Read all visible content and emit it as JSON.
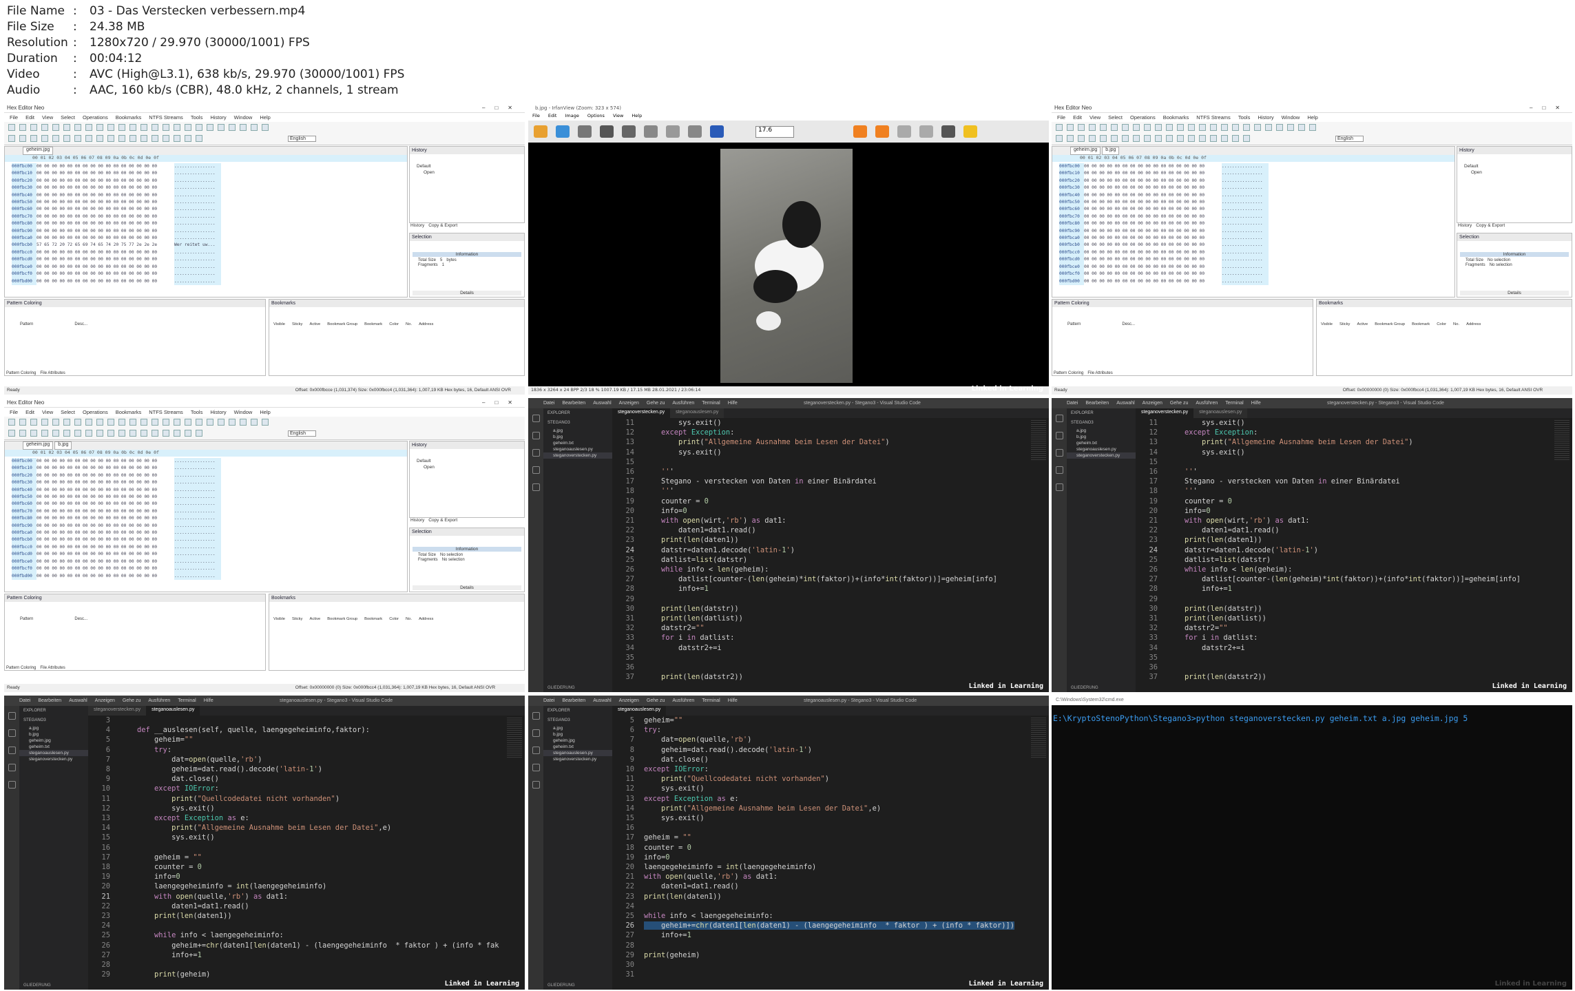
{
  "meta": {
    "rows": [
      {
        "key": "File Name",
        "value": "03 - Das Verstecken verbessern.mp4"
      },
      {
        "key": "File Size",
        "value": "24.38 MB"
      },
      {
        "key": "Resolution",
        "value": "1280x720 / 29.970 (30000/1001) FPS"
      },
      {
        "key": "Duration",
        "value": "00:04:12"
      },
      {
        "key": "Video",
        "value": "AVC (High@L3.1), 638 kb/s, 29.970 (30000/1001) FPS"
      },
      {
        "key": "Audio",
        "value": "AAC, 160 kb/s (CBR), 48.0 kHz, 2 channels, 1 stream"
      }
    ],
    "colon": ":"
  },
  "hex": {
    "title": "Hex Editor Neo",
    "menu": [
      "File",
      "Edit",
      "View",
      "Select",
      "Operations",
      "Bookmarks",
      "NTFS Streams",
      "Tools",
      "History",
      "Window",
      "Help"
    ],
    "tab1": "geheim.jpg",
    "tab2": "b.jpg",
    "lang": "English",
    "header": "00 01 02 03  04 05 06 07  08 09 0a 0b  0c 0d 0e 0f",
    "history": "History",
    "default": "Default",
    "open": "Open",
    "history_tab": "History",
    "copy_export": "Copy & Export",
    "selection": "Selection",
    "information": "Information",
    "total_size": "Total Size",
    "fragments": "Fragments",
    "total_val_1": "5",
    "bytes": "bytes",
    "frag_val_1": "1",
    "no_selection": "No selection",
    "details": "Details",
    "pattern_coloring": "Pattern Coloring",
    "bookmarks": "Bookmarks",
    "pattern_col": "Pattern",
    "desc_col": "Desc...",
    "visible": "Visible",
    "sticky": "Sticky",
    "active": "Active",
    "bm_group": "Bookmark Group",
    "bookmark": "Bookmark",
    "color": "Color",
    "no": "No.",
    "address": "Address",
    "pc_tab": "Pattern Coloring",
    "file_attr": "File Attributes",
    "ready": "Ready",
    "status1": "Offset: 0x000fbcce (1,031,374)  Size: 0x000fbcc4 (1,031,364): 1,007,19 KB  Hex bytes, 16, Default ANSI  OVR",
    "status2": "Offset: 0x00000000 (0)  Size: 0x000fbcc4 (1,031,364): 1,007,19 KB  Hex bytes, 16, Default ANSI  OVR",
    "offsets": [
      "000fbc00",
      "000fbc10",
      "000fbc20",
      "000fbc30",
      "000fbc40",
      "000fbc50",
      "000fbc60",
      "000fbc70",
      "000fbc80",
      "000fbc90",
      "000fbca0",
      "000fbcb0",
      "000fbcc0",
      "000fbcd0",
      "000fbce0",
      "000fbcf0",
      "000fbd00"
    ],
    "bytes_row": "00 00 00 00  00 00 00 00  00 00 00 00  00 00 00 00",
    "ascii_row": "................",
    "msg_row": "57 65 72 20  72 65 69 74  65 74 20 75  77 2e 2e 2e",
    "msg_ascii": "Wer reitet uw..."
  },
  "viewer": {
    "title": "b.jpg - IrfanView (Zoom: 323 x 574)",
    "menu": [
      "File",
      "Edit",
      "Image",
      "Options",
      "View",
      "Help"
    ],
    "zoom": "17.6",
    "status": "1836 x 3264 x 24 BPP   2/3   18 %   1007.19 KB / 17.15 MB   28.01.2021 / 23:06:14"
  },
  "vs": {
    "menu": [
      "Datei",
      "Bearbeiten",
      "Auswahl",
      "Anzeigen",
      "Gehe zu",
      "Ausführen",
      "Terminal",
      "Hilfe"
    ],
    "title_a": "steganoverstecken.py - Stegano3 - Visual Studio Code",
    "title_b": "steganoauslesen.py - Stegano3 - Visual Studio Code",
    "explorer": "EXPLORER",
    "folder": "STEGANO3",
    "gliederung": "GLIEDERUNG",
    "files": [
      "a.jpg",
      "b.jpg",
      "geheim.txt",
      "steganoauslesen.py",
      "steganoverstecken.py"
    ],
    "files7": [
      "a.jpg",
      "b.jpg",
      "geheim.jpg",
      "geheim.txt",
      "steganoauslesen.py",
      "steganoverstecken.py"
    ],
    "files8": [
      "a.jpg",
      "b.jpg",
      "geheim.jpg",
      "geheim.txt",
      "steganoauslesen.py",
      "steganoverstecken.py"
    ],
    "tab_ver": "steganoverstecken.py",
    "tab_aus": "steganoauslesen.py",
    "code_ver": [
      [
        "11",
        "        sys.exit()"
      ],
      [
        "12",
        "    except Exception:"
      ],
      [
        "13",
        "        print(\"Allgemeine Ausnahme beim Lesen der Datei\")"
      ],
      [
        "14",
        "        sys.exit()"
      ],
      [
        "15",
        ""
      ],
      [
        "16",
        "    '''"
      ],
      [
        "17",
        "    Stegano - verstecken von Daten in einer Binärdatei"
      ],
      [
        "18",
        "    '''"
      ],
      [
        "19",
        "    counter = 0"
      ],
      [
        "20",
        "    info=0"
      ],
      [
        "21",
        "    with open(wirt,'rb') as dat1:"
      ],
      [
        "22",
        "        daten1=dat1.read()"
      ],
      [
        "23",
        "    print(len(daten1))"
      ],
      [
        "24",
        "    datstr=daten1.decode('latin-1')"
      ],
      [
        "25",
        "    datlist=list(datstr)"
      ],
      [
        "26",
        "    while info < len(geheim):"
      ],
      [
        "27",
        "        datlist[counter-(len(geheim)*int(faktor))+(info*int(faktor))]=geheim[info]"
      ],
      [
        "28",
        "        info+=1"
      ],
      [
        "29",
        ""
      ],
      [
        "30",
        "    print(len(datstr))"
      ],
      [
        "31",
        "    print(len(datlist))"
      ],
      [
        "32",
        "    datstr2=\"\""
      ],
      [
        "33",
        "    for i in datlist:"
      ],
      [
        "34",
        "        datstr2+=i"
      ],
      [
        "35",
        ""
      ],
      [
        "36",
        ""
      ],
      [
        "37",
        "    print(len(datstr2))"
      ]
    ],
    "code_aus7": [
      [
        "3",
        ""
      ],
      [
        "4",
        "    def __auslesen(self, quelle, laengegeheiminfo,faktor):"
      ],
      [
        "5",
        "        geheim=\"\""
      ],
      [
        "6",
        "        try:"
      ],
      [
        "7",
        "            dat=open(quelle,'rb')"
      ],
      [
        "8",
        "            geheim=dat.read().decode('latin-1')"
      ],
      [
        "9",
        "            dat.close()"
      ],
      [
        "10",
        "        except IOError:"
      ],
      [
        "11",
        "            print(\"Quellcodedatei nicht vorhanden\")"
      ],
      [
        "12",
        "            sys.exit()"
      ],
      [
        "13",
        "        except Exception as e:"
      ],
      [
        "14",
        "            print(\"Allgemeine Ausnahme beim Lesen der Datei\",e)"
      ],
      [
        "15",
        "            sys.exit()"
      ],
      [
        "16",
        ""
      ],
      [
        "17",
        "        geheim = \"\""
      ],
      [
        "18",
        "        counter = 0"
      ],
      [
        "19",
        "        info=0"
      ],
      [
        "20",
        "        laengegeheiminfo = int(laengegeheiminfo)"
      ],
      [
        "21",
        "        with open(quelle,'rb') as dat1:"
      ],
      [
        "22",
        "            daten1=dat1.read()"
      ],
      [
        "23",
        "        print(len(daten1))"
      ],
      [
        "24",
        ""
      ],
      [
        "25",
        "        while info < laengegeheiminfo:"
      ],
      [
        "26",
        "            geheim+=chr(daten1[len(daten1) - (laengegeheiminfo  * faktor ) + (info * fak"
      ],
      [
        "27",
        "            info+=1"
      ],
      [
        "28",
        ""
      ],
      [
        "29",
        "        print(geheim)"
      ]
    ],
    "code_aus8": [
      [
        "5",
        "geheim=\"\""
      ],
      [
        "6",
        "try:"
      ],
      [
        "7",
        "    dat=open(quelle,'rb')"
      ],
      [
        "8",
        "    geheim=dat.read().decode('latin-1')"
      ],
      [
        "9",
        "    dat.close()"
      ],
      [
        "10",
        "except IOError:"
      ],
      [
        "11",
        "    print(\"Quellcodedatei nicht vorhanden\")"
      ],
      [
        "12",
        "    sys.exit()"
      ],
      [
        "13",
        "except Exception as e:"
      ],
      [
        "14",
        "    print(\"Allgemeine Ausnahme beim Lesen der Datei\",e)"
      ],
      [
        "15",
        "    sys.exit()"
      ],
      [
        "16",
        ""
      ],
      [
        "17",
        "geheim = \"\""
      ],
      [
        "18",
        "counter = 0"
      ],
      [
        "19",
        "info=0"
      ],
      [
        "20",
        "laengegeheiminfo = int(laengegeheiminfo)"
      ],
      [
        "21",
        "with open(quelle,'rb') as dat1:"
      ],
      [
        "22",
        "    daten1=dat1.read()"
      ],
      [
        "23",
        "print(len(daten1))"
      ],
      [
        "24",
        ""
      ],
      [
        "25",
        "while info < laengegeheiminfo:"
      ],
      [
        "26",
        "    geheim+=chr(daten1[len(daten1) - (laengegeheiminfo  * faktor ) + (info * faktor)])"
      ],
      [
        "27",
        "    info+=1"
      ],
      [
        "28",
        ""
      ],
      [
        "29",
        "print(geheim)"
      ],
      [
        "30",
        ""
      ],
      [
        "31",
        ""
      ]
    ]
  },
  "cmd": {
    "title": "C:\\Windows\\System32\\cmd.exe",
    "line": "E:\\KryptoStenoPython\\Stegano3>python steganoverstecken.py geheim.txt a.jpg geheim.jpg 5"
  },
  "brand": "Linked in Learning"
}
